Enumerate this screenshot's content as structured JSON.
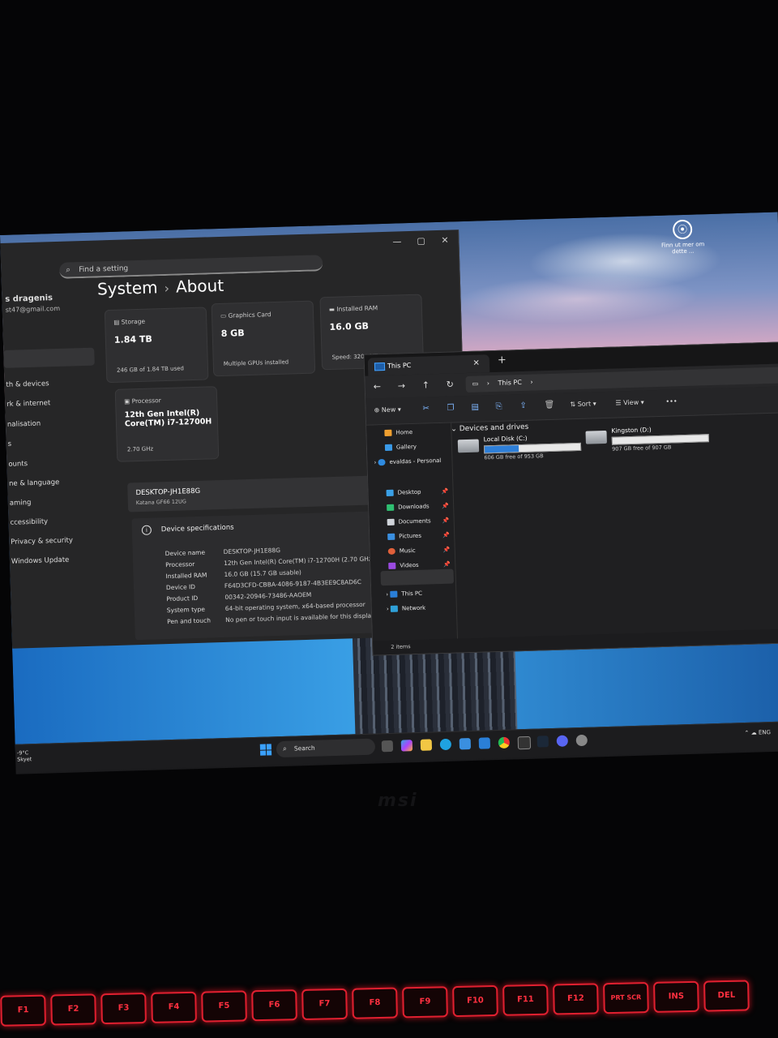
{
  "desktop": {
    "shortcut_label": "Finn ut mer om dette ..."
  },
  "settings": {
    "search_placeholder": "Find a setting",
    "user_name": "s dragenis",
    "user_email": "st47@gmail.com",
    "breadcrumb": {
      "parent": "System",
      "current": "About"
    },
    "nav": [
      "th & devices",
      "rk & internet",
      "nalisation",
      "s",
      "ounts",
      "ne & language",
      "aming",
      "ccessibility",
      "Privacy & security",
      "Windows Update"
    ],
    "cards": [
      {
        "label": "Storage",
        "value": "1.84 TB",
        "sub": "246 GB of 1.84 TB used"
      },
      {
        "label": "Graphics Card",
        "value": "8 GB",
        "sub": "Multiple GPUs installed"
      },
      {
        "label": "Installed RAM",
        "value": "16.0 GB",
        "sub": "Speed: 3200 MT/s"
      },
      {
        "label": "Processor",
        "value": "12th Gen Intel(R) Core(TM) i7-12700H",
        "sub": "2.70 GHz"
      }
    ],
    "device": {
      "name": "DESKTOP-JH1E88G",
      "model": "Katana GF66 12UG"
    },
    "specs": {
      "title": "Device specifications",
      "rows": [
        {
          "key": "Device name",
          "value": "DESKTOP-JH1E88G"
        },
        {
          "key": "Processor",
          "value": "12th Gen Intel(R) Core(TM) i7-12700H (2.70 GHz)"
        },
        {
          "key": "Installed RAM",
          "value": "16.0 GB (15.7 GB usable)"
        },
        {
          "key": "Device ID",
          "value": "F64D3CFD-CBBA-4086-9187-4B3EE9C8AD6C"
        },
        {
          "key": "Product ID",
          "value": "00342-20946-73486-AAOEM"
        },
        {
          "key": "System type",
          "value": "64-bit operating system, x64-based processor"
        },
        {
          "key": "Pen and touch",
          "value": "No pen or touch input is available for this display"
        }
      ]
    }
  },
  "explorer": {
    "tab_title": "This PC",
    "address": "This PC",
    "commands": {
      "new": "New",
      "sort": "Sort",
      "view": "View",
      "more": "•••"
    },
    "nav": {
      "home": "Home",
      "gallery": "Gallery",
      "onedrive": "evaldas - Personal",
      "desktop": "Desktop",
      "downloads": "Downloads",
      "documents": "Documents",
      "pictures": "Pictures",
      "music": "Music",
      "videos": "Videos",
      "thispc": "This PC",
      "network": "Network"
    },
    "section": "Devices and drives",
    "drives": [
      {
        "name": "Local Disk (C:)",
        "free": "606 GB free of 953 GB",
        "used_fraction": 0.36
      },
      {
        "name": "Kingston (D:)",
        "free": "907 GB free of 907 GB",
        "used_fraction": 0.0
      }
    ],
    "status": "2 items"
  },
  "taskbar": {
    "weather_temp": "-9°C",
    "weather_desc": "Skyet",
    "search": "Search",
    "tray_lang": "ENG"
  },
  "bezel": {
    "brand": "msi"
  },
  "keys": [
    "F1",
    "F2",
    "F3",
    "F4",
    "F5",
    "F6",
    "F7",
    "F8",
    "F9",
    "F10",
    "F11",
    "F12",
    "PRT SCR",
    "INS",
    "DEL"
  ]
}
